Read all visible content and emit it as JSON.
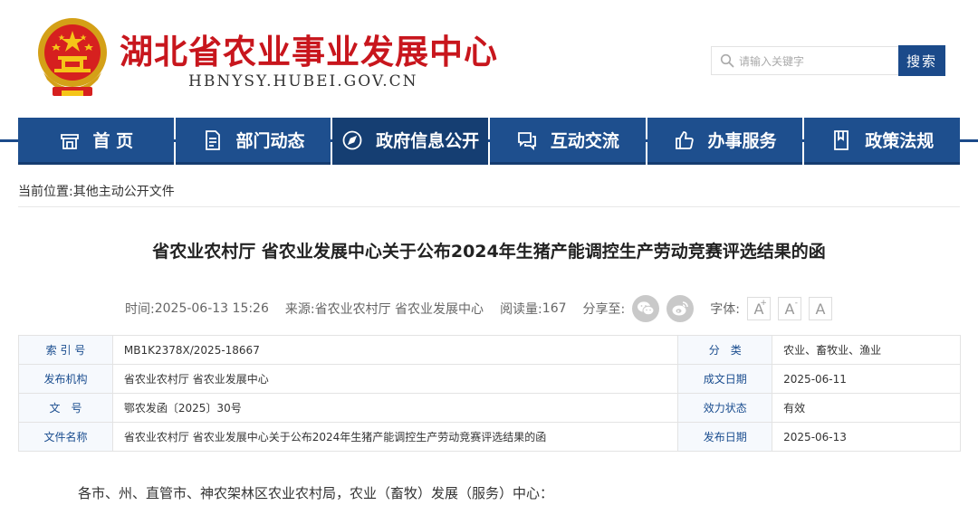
{
  "header": {
    "site_title": "湖北省农业事业发展中心",
    "site_domain": "HBNYSY.HUBEI.GOV.CN",
    "emblem_icon": "national-emblem-icon",
    "search": {
      "placeholder": "请输入关键字",
      "button_label": "搜索"
    }
  },
  "nav": {
    "items": [
      {
        "label": "首 页",
        "icon": "home-icon"
      },
      {
        "label": "部门动态",
        "icon": "document-icon"
      },
      {
        "label": "政府信息公开",
        "icon": "compass-icon"
      },
      {
        "label": "互动交流",
        "icon": "chat-icon"
      },
      {
        "label": "办事服务",
        "icon": "thumbs-up-icon"
      },
      {
        "label": "政策法规",
        "icon": "book-icon"
      }
    ],
    "active_index": 2,
    "colors": {
      "bar": "#1e4f8e",
      "active": "#153e72"
    }
  },
  "breadcrumb": {
    "prefix": "当前位置:",
    "current": "其他主动公开文件"
  },
  "article": {
    "title": "省农业农村厅 省农业发展中心关于公布2024年生猪产能调控生产劳动竞赛评选结果的函",
    "meta": {
      "time_label": "时间:",
      "time_value": "2025-06-13 15:26",
      "source_label": "来源:",
      "source_value": "省农业农村厅 省农业发展中心",
      "reads_label": "阅读量:",
      "reads_value": "167",
      "share_label": "分享至:",
      "font_label": "字体:",
      "font_sizes": [
        "A",
        "A",
        "A"
      ]
    },
    "info_table": {
      "rows": [
        {
          "l1": "索 引 号",
          "v1": "MB1K2378X/2025-18667",
          "l2": "分　类",
          "v2": "农业、畜牧业、渔业"
        },
        {
          "l1": "发布机构",
          "v1": "省农业农村厅 省农业发展中心",
          "l2": "成文日期",
          "v2": "2025-06-11"
        },
        {
          "l1": "文　号",
          "v1": "鄂农发函〔2025〕30号",
          "l2": "效力状态",
          "v2": "有效"
        },
        {
          "l1": "文件名称",
          "v1": "省农业农村厅 省农业发展中心关于公布2024年生猪产能调控生产劳动竞赛评选结果的函",
          "l2": "发布日期",
          "v2": "2025-06-13"
        }
      ]
    },
    "salutation": "各市、州、直管市、神农架林区农业农村局，农业（畜牧）发展（服务）中心："
  },
  "colors": {
    "title_red": "#c8161d",
    "nav_blue": "#1e4f8e",
    "label_blue": "#1a4d8f"
  }
}
